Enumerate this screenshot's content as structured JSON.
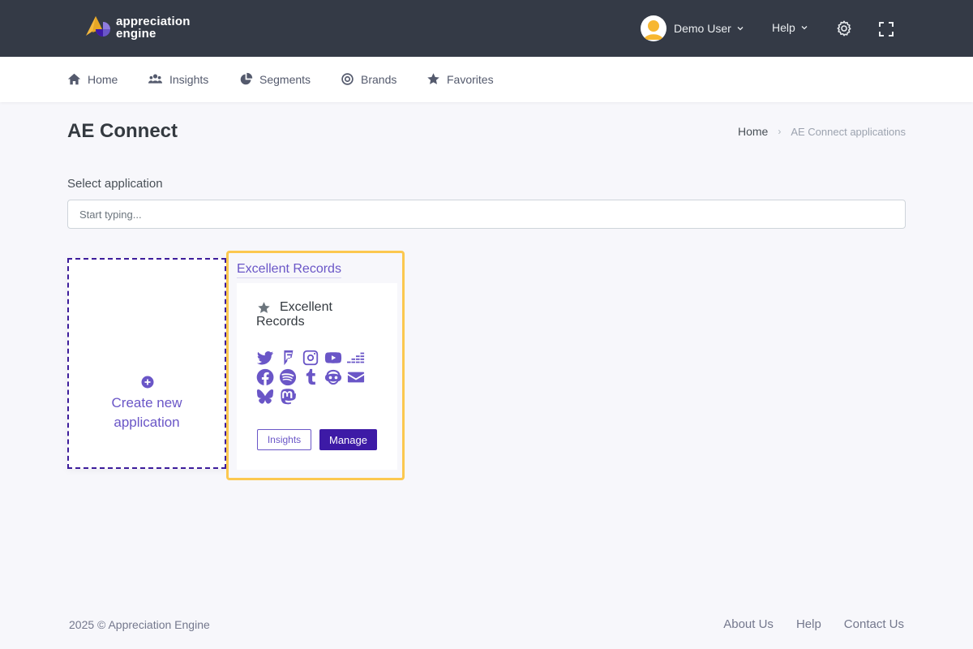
{
  "header": {
    "logo_line1": "appreciation",
    "logo_line2": "engine",
    "user_name": "Demo User",
    "help_label": "Help"
  },
  "nav": {
    "items": [
      {
        "label": "Home",
        "icon": "home-icon"
      },
      {
        "label": "Insights",
        "icon": "users-icon"
      },
      {
        "label": "Segments",
        "icon": "pie-chart-icon"
      },
      {
        "label": "Brands",
        "icon": "target-icon"
      },
      {
        "label": "Favorites",
        "icon": "star-icon"
      }
    ]
  },
  "page": {
    "title": "AE Connect",
    "breadcrumb_home": "Home",
    "breadcrumb_current": "AE Connect applications"
  },
  "search": {
    "label": "Select application",
    "placeholder": "Start typing..."
  },
  "create_card": {
    "label_line1": "Create new",
    "label_line2": "application"
  },
  "app_card": {
    "link_title": "Excellent Records",
    "name": "Excellent Records",
    "insights_label": "Insights",
    "manage_label": "Manage",
    "services": [
      "twitter",
      "foursquare",
      "instagram",
      "youtube",
      "deezer",
      "facebook",
      "spotify",
      "tumblr",
      "napster",
      "email",
      "bluesky",
      "mastodon"
    ]
  },
  "footer": {
    "copyright": "2025 © Appreciation Engine",
    "links": [
      "About Us",
      "Help",
      "Contact Us"
    ]
  },
  "colors": {
    "topbar": "#343a46",
    "accent": "#6a56c7",
    "primary_button": "#3d1aa6",
    "highlight_border": "#fcc84f"
  }
}
